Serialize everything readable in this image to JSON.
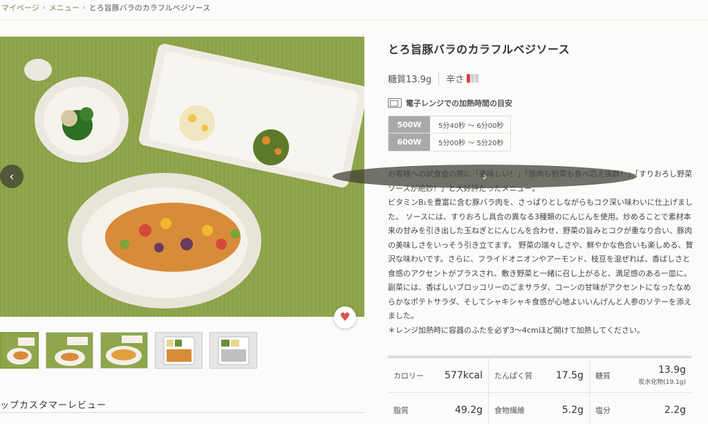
{
  "breadcrumb": {
    "home": "マイページ",
    "menu": "メニュー",
    "current": "とろ旨豚バラのカラフルベジソース"
  },
  "product": {
    "title": "とろ旨豚バラのカラフルベジソース",
    "sugar": "糖質13.9g",
    "spicy_label": "辛さ",
    "spicy_level": 1,
    "spicy_max": 3,
    "heat_title": "電子レンジでの加熱時間の目安",
    "heat": [
      {
        "watt": "500W",
        "time": "5分40秒 〜 6分00秒"
      },
      {
        "watt": "600W",
        "time": "5分00秒 〜 5分20秒"
      }
    ],
    "description": [
      "お客様への試食会の際に「美味しい！」「豚肉も野菜も食べ応え抜群！」「すりおろし野菜ソースが絶妙！」と大好評だったメニュー。",
      "ビタミンB₁を豊富に含む豚バラ肉を、さっぱりとしながらもコク深い味わいに仕上げました。 ソースには、すりおろし具合の異なる3種類のにんじんを使用。炒めることで素材本来の甘みを引き出した玉ねぎとにんじんを合わせ、野菜の旨みとコクが重なり合い、豚肉の美味しさをいっそう引き立てます。 野菜の瑞々しさや、鮮やかな色合いも楽しめる、贅沢な味わいです。さらに、フライドオニオンやアーモンド、枝豆を混ぜれば、香ばしさと食感のアクセントがプラスされ、敷き野菜と一緒に召し上がると、満足感のある一皿に。 副菜には、香ばしいブロッコリーのごまサラダ、コーンの甘味がアクセントになったなめらかなポテトサラダ、そしてシャキシャキ食感が心地よいいんげんと人参のソテーを添えました。",
      "＊レンジ加熱時に容器のふたを必ず3〜4cmほど開けて加熱してください。"
    ]
  },
  "nutrition": [
    [
      {
        "label": "カロリー",
        "value": "577kcal"
      },
      {
        "label": "たんぱく質",
        "value": "17.5g"
      },
      {
        "label": "糖質",
        "value": "13.9g",
        "sub": "炭水化物(19.1g)"
      }
    ],
    [
      {
        "label": "脂質",
        "value": "49.2g"
      },
      {
        "label": "食物繊維",
        "value": "5.2g"
      },
      {
        "label": "塩分",
        "value": "2.2g"
      }
    ]
  ],
  "review_title": "ップカスタマーレビュー",
  "icons": {
    "prev": "chevron-left-icon",
    "next": "chevron-right-icon",
    "favorite": "heart-icon",
    "microwave": "microwave-icon"
  },
  "colors": {
    "accent": "#7fa23a",
    "chili_active": "#d9423a",
    "chili_inactive": "#cfcfcf"
  }
}
